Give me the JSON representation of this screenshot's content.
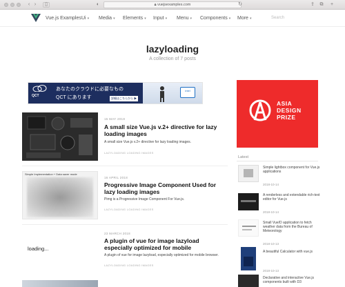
{
  "browser": {
    "url": "vuejsexamples.com"
  },
  "nav": {
    "brand": "Vue.js Examples",
    "items": [
      {
        "label": "Ui"
      },
      {
        "label": "Media"
      },
      {
        "label": "Elements"
      },
      {
        "label": "Input"
      },
      {
        "label": "Menu"
      },
      {
        "label": "Components"
      },
      {
        "label": "More"
      }
    ],
    "search_placeholder": "Search"
  },
  "page": {
    "title": "lazyloading",
    "subtitle": "A collection of 7 posts"
  },
  "ad_banner": {
    "brand": "QCT",
    "line1": "あなたのクラウドに必要なもの",
    "line2": "QCT にあります",
    "cta": "詳細はこちらから ▶",
    "intel": "intel"
  },
  "posts": [
    {
      "date": "15 MAY 2018",
      "title": "A small size Vue.js v.2+ directive for lazy loading images",
      "description": "A small size Vue.js v.2+ directive for lazy loading images.",
      "tags": "LAZYLOADING  LOADING  IMAGES"
    },
    {
      "date": "16 APRIL 2018",
      "title": "Progressive Image Component Used for lazy loading images",
      "description": "Pimg is a Progressive Image Component For Vue.js.",
      "tags": "LAZYLOADING  LOADING  IMAGES",
      "thumb_caption": "Simple Implementation + Data saver mode"
    },
    {
      "date": "23 MARCH 2018",
      "title": "A plugin of vue for image lazyload especially optimized for mobile",
      "description": "A plugin of vue for image lazyload, especially optimized for mobile browser.",
      "tags": "LAZYLOADING  LOADING  IMAGES",
      "thumb_caption": "loading..."
    }
  ],
  "sidebar": {
    "ad_text_line1": "ASIA",
    "ad_text_line2": "DESIGN",
    "ad_text_line3": "PRIZE",
    "latest_title": "Latest",
    "latest": [
      {
        "text": "Simple lightbox component for Vue.js applications",
        "date": "2018-10-14"
      },
      {
        "text": "A renderless and extendable rich-text editor for Vue.js",
        "date": "2018-10-14"
      },
      {
        "text": "Small Vue/D application to fetch weather data from the Bureau of Meteorology",
        "date": "2018-10-13"
      },
      {
        "text": "A beautiful Calculator with vue.js",
        "date": "2018-10-13"
      },
      {
        "text": "Declarative and interactive Vue.js components built with D3",
        "date": ""
      }
    ]
  },
  "colors": {
    "accent_red": "#ee2b2b",
    "vue_dark": "#35495e",
    "vue_green": "#41b883"
  }
}
